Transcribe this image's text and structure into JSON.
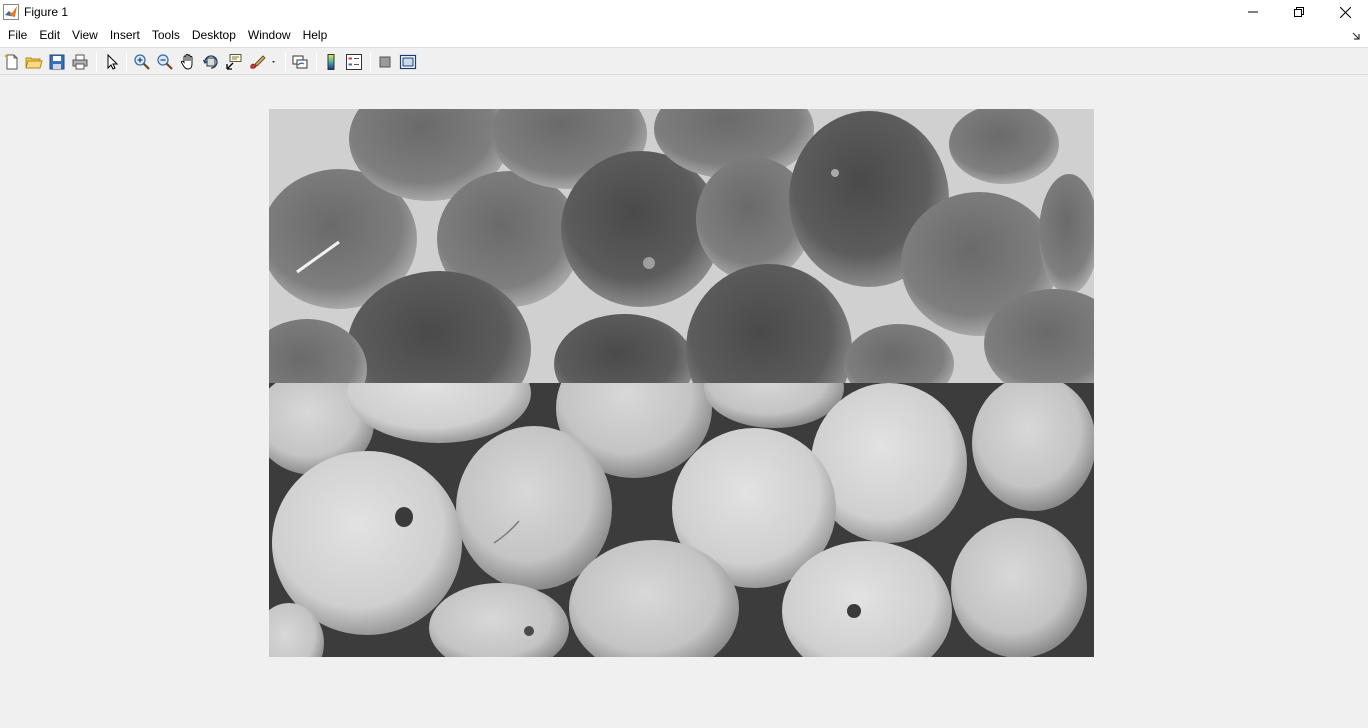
{
  "window": {
    "title": "Figure 1",
    "controls": [
      "minimize",
      "restore",
      "close"
    ]
  },
  "menu": {
    "items": [
      "File",
      "Edit",
      "View",
      "Insert",
      "Tools",
      "Desktop",
      "Window",
      "Help"
    ]
  },
  "toolbar": {
    "buttons": [
      {
        "name": "new-figure-icon"
      },
      {
        "name": "open-file-icon"
      },
      {
        "name": "save-icon"
      },
      {
        "name": "print-icon"
      },
      {
        "name": "edit-plot-arrow-icon"
      },
      {
        "name": "zoom-in-icon"
      },
      {
        "name": "zoom-out-icon"
      },
      {
        "name": "pan-hand-icon"
      },
      {
        "name": "rotate-3d-icon"
      },
      {
        "name": "data-cursor-icon"
      },
      {
        "name": "brush-icon"
      },
      {
        "name": "link-plot-icon"
      },
      {
        "name": "colorbar-icon"
      },
      {
        "name": "legend-icon"
      },
      {
        "name": "hide-plot-tools-icon"
      },
      {
        "name": "show-plot-tools-icon"
      }
    ]
  },
  "figure": {
    "content": "grayscale image: inverted oranges (top half) and normal oranges (bottom half)",
    "colors": {
      "canvas_background": "#f0f0f0",
      "top_half_background": "#c9c9c9",
      "bottom_half_background": "#4a4a4a"
    }
  }
}
